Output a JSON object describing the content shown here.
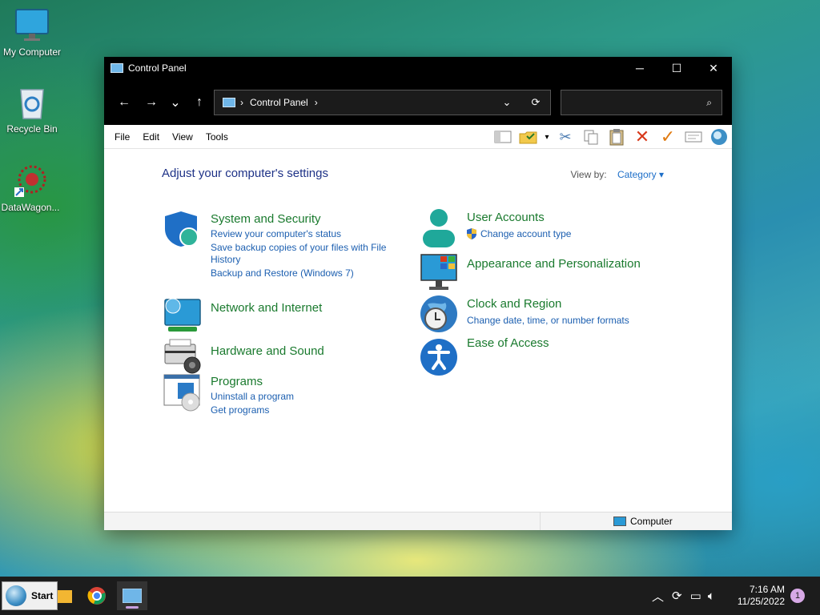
{
  "desktop": {
    "icons": [
      {
        "label": "My Computer"
      },
      {
        "label": "Recycle Bin"
      },
      {
        "label": "DataWagon..."
      }
    ]
  },
  "window": {
    "title": "Control Panel",
    "controls": {
      "minimize": "─",
      "maximize": "☐",
      "close": "✕"
    },
    "nav": {
      "back": "←",
      "forward": "→",
      "recent": "⌄",
      "up": "↑"
    },
    "address": {
      "crumb": "Control Panel",
      "separator": "›",
      "dropdown": "⌄",
      "refresh": "⟳"
    },
    "search": {
      "placeholder": "",
      "icon": "⌕"
    },
    "menu": [
      "File",
      "Edit",
      "View",
      "Tools"
    ],
    "toolbar_icons": [
      "layout-icon",
      "folder-check-icon",
      "dropdown-icon",
      "cut-icon",
      "copy-icon",
      "paste-icon",
      "delete-icon",
      "check-icon",
      "properties-icon",
      "shell-icon"
    ],
    "content": {
      "heading": "Adjust your computer's settings",
      "view_by_label": "View by:",
      "view_by_value": "Category",
      "categories": [
        {
          "title": "System and Security",
          "links": [
            "Review your computer's status",
            "Save backup copies of your files with File",
            "History",
            "Backup and Restore (Windows 7)"
          ]
        },
        {
          "title": "Network and Internet",
          "links": []
        },
        {
          "title": "Hardware and Sound",
          "links": []
        },
        {
          "title": "Programs",
          "links": [
            "Uninstall a program",
            "Get programs"
          ]
        },
        {
          "title": "User Accounts",
          "links": [
            "Change account type"
          ]
        },
        {
          "title": "Appearance and Personalization",
          "links": []
        },
        {
          "title": "Clock and Region",
          "links": [
            "Change date, time, or number formats"
          ]
        },
        {
          "title": "Ease of Access",
          "links": []
        }
      ]
    },
    "status": {
      "location": "Computer"
    }
  },
  "taskbar": {
    "start_label": "Start",
    "time": "7:16 AM",
    "date": "11/25/2022",
    "notification_count": "1"
  }
}
